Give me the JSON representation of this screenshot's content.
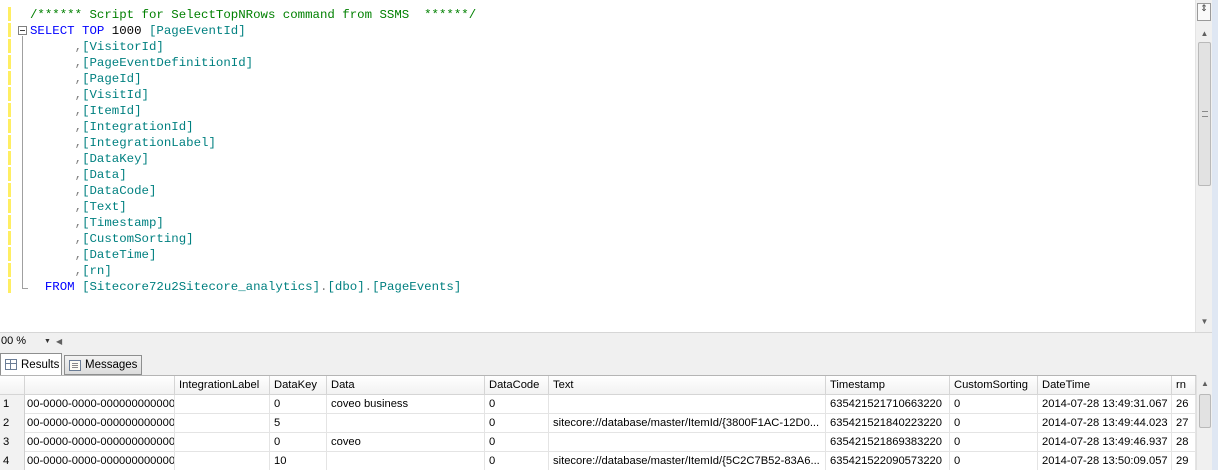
{
  "editor": {
    "lines": [
      {
        "parts": [
          {
            "t": "/****** Script for SelectTopNRows command from SSMS  ******/",
            "c": "cm"
          }
        ]
      },
      {
        "parts": [
          {
            "t": "SELECT TOP ",
            "c": "kw"
          },
          {
            "t": "1000 ",
            "c": "tx"
          },
          {
            "t": "[PageEventId]",
            "c": "ob"
          }
        ]
      },
      {
        "parts": [
          {
            "t": "      ,",
            "c": "pl"
          },
          {
            "t": "[VisitorId]",
            "c": "ob"
          }
        ]
      },
      {
        "parts": [
          {
            "t": "      ,",
            "c": "pl"
          },
          {
            "t": "[PageEventDefinitionId]",
            "c": "ob"
          }
        ]
      },
      {
        "parts": [
          {
            "t": "      ,",
            "c": "pl"
          },
          {
            "t": "[PageId]",
            "c": "ob"
          }
        ]
      },
      {
        "parts": [
          {
            "t": "      ,",
            "c": "pl"
          },
          {
            "t": "[VisitId]",
            "c": "ob"
          }
        ]
      },
      {
        "parts": [
          {
            "t": "      ,",
            "c": "pl"
          },
          {
            "t": "[ItemId]",
            "c": "ob"
          }
        ]
      },
      {
        "parts": [
          {
            "t": "      ,",
            "c": "pl"
          },
          {
            "t": "[IntegrationId]",
            "c": "ob"
          }
        ]
      },
      {
        "parts": [
          {
            "t": "      ,",
            "c": "pl"
          },
          {
            "t": "[IntegrationLabel]",
            "c": "ob"
          }
        ]
      },
      {
        "parts": [
          {
            "t": "      ,",
            "c": "pl"
          },
          {
            "t": "[DataKey]",
            "c": "ob"
          }
        ]
      },
      {
        "parts": [
          {
            "t": "      ,",
            "c": "pl"
          },
          {
            "t": "[Data]",
            "c": "ob"
          }
        ]
      },
      {
        "parts": [
          {
            "t": "      ,",
            "c": "pl"
          },
          {
            "t": "[DataCode]",
            "c": "ob"
          }
        ]
      },
      {
        "parts": [
          {
            "t": "      ,",
            "c": "pl"
          },
          {
            "t": "[Text]",
            "c": "ob"
          }
        ]
      },
      {
        "parts": [
          {
            "t": "      ,",
            "c": "pl"
          },
          {
            "t": "[Timestamp]",
            "c": "ob"
          }
        ]
      },
      {
        "parts": [
          {
            "t": "      ,",
            "c": "pl"
          },
          {
            "t": "[CustomSorting]",
            "c": "ob"
          }
        ]
      },
      {
        "parts": [
          {
            "t": "      ,",
            "c": "pl"
          },
          {
            "t": "[DateTime]",
            "c": "ob"
          }
        ]
      },
      {
        "parts": [
          {
            "t": "      ,",
            "c": "pl"
          },
          {
            "t": "[rn]",
            "c": "ob"
          }
        ]
      },
      {
        "parts": [
          {
            "t": "  FROM ",
            "c": "kw"
          },
          {
            "t": "[Sitecore72u2Sitecore_analytics]",
            "c": "ob"
          },
          {
            "t": ".",
            "c": "pl"
          },
          {
            "t": "[dbo]",
            "c": "ob"
          },
          {
            "t": ".",
            "c": "pl"
          },
          {
            "t": "[PageEvents]",
            "c": "ob"
          }
        ]
      }
    ],
    "split_glyph": "⇕",
    "scroll_up_glyph": "▲",
    "scroll_down_glyph": "▼"
  },
  "zoom": {
    "value": "00 %",
    "arrow_glyph": "▼",
    "scroll_left_glyph": "◀"
  },
  "tabs": [
    {
      "label": "Results"
    },
    {
      "label": "Messages"
    }
  ],
  "grid": {
    "columns": [
      "",
      "",
      "IntegrationLabel",
      "DataKey",
      "Data",
      "DataCode",
      "Text",
      "Timestamp",
      "CustomSorting",
      "DateTime",
      "rn"
    ],
    "rows": [
      [
        "1",
        "00-0000-0000-000000000000",
        "",
        "0",
        "coveo business",
        "0",
        "",
        "635421521710663220",
        "0",
        "2014-07-28 13:49:31.067",
        "26"
      ],
      [
        "2",
        "00-0000-0000-000000000000",
        "",
        "5",
        "",
        "0",
        "sitecore://database/master/ItemId/{3800F1AC-12D0...",
        "635421521840223220",
        "0",
        "2014-07-28 13:49:44.023",
        "27"
      ],
      [
        "3",
        "00-0000-0000-000000000000",
        "",
        "0",
        "coveo",
        "0",
        "",
        "635421521869383220",
        "0",
        "2014-07-28 13:49:46.937",
        "28"
      ],
      [
        "4",
        "00-0000-0000-000000000000",
        "",
        "10",
        "",
        "0",
        "sitecore://database/master/ItemId/{5C2C7B52-83A6...",
        "635421522090573220",
        "0",
        "2014-07-28 13:50:09.057",
        "29"
      ]
    ],
    "scroll_up_glyph": "▲"
  }
}
